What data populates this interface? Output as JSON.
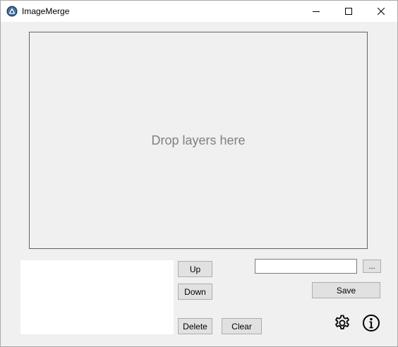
{
  "window": {
    "title": "ImageMerge",
    "app_icon": "imagemerge-logo-icon",
    "controls": {
      "minimize_icon": "minimize-icon",
      "maximize_icon": "maximize-icon",
      "close_icon": "close-icon"
    }
  },
  "drop_area": {
    "placeholder": "Drop layers here"
  },
  "layers": {
    "items": []
  },
  "buttons": {
    "up": "Up",
    "down": "Down",
    "delete": "Delete",
    "clear": "Clear",
    "browse": "...",
    "save": "Save"
  },
  "output": {
    "path_value": ""
  },
  "icons": {
    "settings": "gear-icon",
    "about": "info-icon"
  },
  "colors": {
    "window_bg": "#f0f0f0",
    "button_bg": "#e1e1e1",
    "button_border": "#adadad",
    "placeholder_text": "#808080"
  }
}
